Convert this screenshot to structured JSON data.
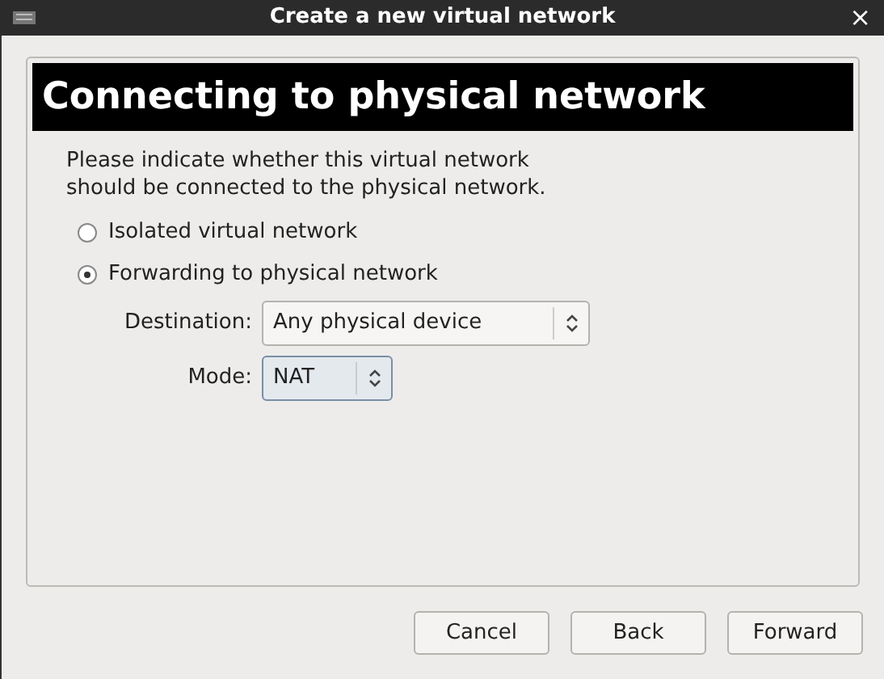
{
  "window": {
    "title": "Create a new virtual network",
    "close": "×"
  },
  "header": "Connecting to physical network",
  "description": "Please indicate whether this virtual network should be connected to the physical network.",
  "options": [
    {
      "label": "Isolated virtual network",
      "selected": false
    },
    {
      "label": "Forwarding to physical network",
      "selected": true
    }
  ],
  "fields": [
    {
      "label": "Destination:",
      "value": "Any physical device",
      "focused": false
    },
    {
      "label": "Mode:",
      "value": "NAT",
      "focused": true
    }
  ],
  "buttons": [
    "Cancel",
    "Back",
    "Forward"
  ]
}
